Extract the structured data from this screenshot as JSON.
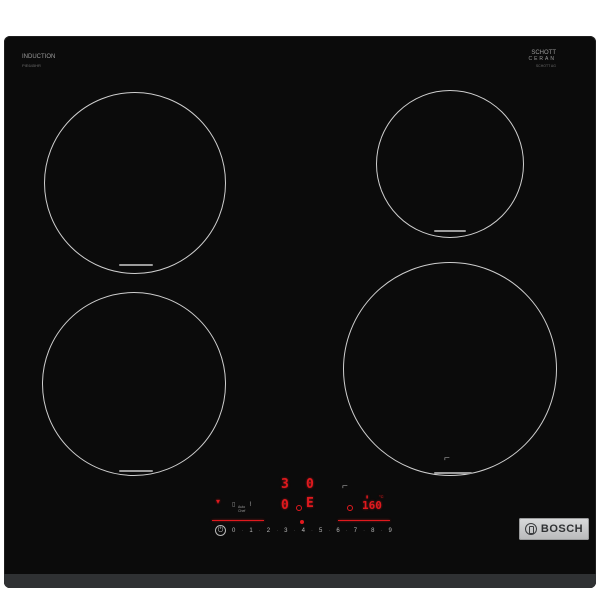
{
  "labels": {
    "induction": "INDUCTION",
    "induction_sub": "PIE645HR",
    "schott": "SCHOTT",
    "ceran": "CERAN",
    "schott_sub": "SCHOTT AG"
  },
  "displays": {
    "zone_top_left": "3",
    "zone_top_right": "0",
    "zone_bottom_left": "0",
    "zone_bottom_right": "E",
    "temperature": "160",
    "temperature_unit": "°C"
  },
  "function_labels": {
    "line1": "Auto",
    "line2": "Chef"
  },
  "power_scale": {
    "power_symbol": "⏻",
    "steps": [
      "0",
      "1",
      "2",
      "3",
      "4",
      "5",
      "6",
      "7",
      "8",
      "9"
    ]
  },
  "brand": {
    "name": "BOSCH"
  },
  "colors": {
    "glass": "#0b0b0b",
    "display_red": "#e0191e",
    "zone_ring": "#cfcfcf",
    "badge": "#c9cacb"
  },
  "icons": {
    "wifi": "wifi-icon",
    "pan": "pan-icon",
    "timer": "timer-icon",
    "power": "power-icon",
    "brand_logo": "bosch-logo-icon"
  }
}
